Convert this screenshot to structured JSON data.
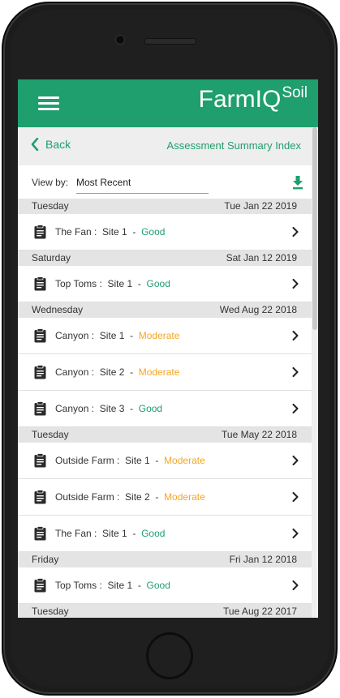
{
  "app": {
    "logo_main": "FarmIQ",
    "logo_sup": "Soil"
  },
  "nav": {
    "back_label": "Back",
    "title": "Assessment Summary Index"
  },
  "filter": {
    "view_by_label": "View by:",
    "selected": "Most Recent"
  },
  "icons": {
    "menu": "hamburger-menu-icon",
    "back": "chevron-left-icon",
    "download": "download-icon",
    "clipboard": "clipboard-icon",
    "row_arrow": "chevron-right-icon"
  },
  "colors": {
    "brand": "#1f9e6e",
    "good": "#1f9e6e",
    "moderate": "#f5a623"
  },
  "groups": [
    {
      "day": "Tuesday",
      "date": "Tue Jan 22 2019",
      "items": [
        {
          "farm": "The Fan :",
          "site": "Site 1",
          "sep": "-",
          "status": "Good",
          "status_class": "good"
        }
      ]
    },
    {
      "day": "Saturday",
      "date": "Sat Jan 12 2019",
      "items": [
        {
          "farm": "Top Toms :",
          "site": "Site 1",
          "sep": "-",
          "status": "Good",
          "status_class": "good"
        }
      ]
    },
    {
      "day": "Wednesday",
      "date": "Wed Aug 22 2018",
      "items": [
        {
          "farm": "Canyon :",
          "site": "Site 1",
          "sep": "-",
          "status": "Moderate",
          "status_class": "moderate"
        },
        {
          "farm": "Canyon :",
          "site": "Site 2",
          "sep": "-",
          "status": "Moderate",
          "status_class": "moderate"
        },
        {
          "farm": "Canyon :",
          "site": "Site 3",
          "sep": "-",
          "status": "Good",
          "status_class": "good"
        }
      ]
    },
    {
      "day": "Tuesday",
      "date": "Tue May 22 2018",
      "items": [
        {
          "farm": "Outside Farm :",
          "site": "Site 1",
          "sep": "-",
          "status": "Moderate",
          "status_class": "moderate"
        },
        {
          "farm": "Outside Farm :",
          "site": "Site 2",
          "sep": "-",
          "status": "Moderate",
          "status_class": "moderate"
        },
        {
          "farm": "The Fan :",
          "site": "Site 1",
          "sep": "-",
          "status": "Good",
          "status_class": "good"
        }
      ]
    },
    {
      "day": "Friday",
      "date": "Fri Jan 12 2018",
      "items": [
        {
          "farm": "Top Toms :",
          "site": "Site 1",
          "sep": "-",
          "status": "Good",
          "status_class": "good"
        }
      ]
    },
    {
      "day": "Tuesday",
      "date": "Tue Aug 22 2017",
      "items": []
    }
  ]
}
